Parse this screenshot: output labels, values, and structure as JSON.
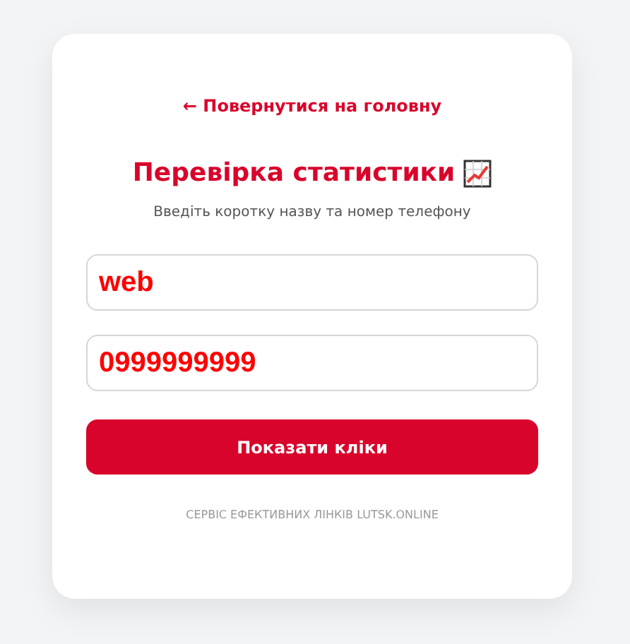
{
  "back_link": "← Повернутися на головну",
  "title": "Перевірка статистики",
  "subtitle": "Введіть коротку назву та номер телефону",
  "fields": [
    {
      "value": "web"
    },
    {
      "value": "0999999999"
    }
  ],
  "submit_button": "Показати кліки",
  "footer": "СЕРВІС ЕФЕКТИВНИХ ЛІНКІВ LUTSK.ONLINE"
}
